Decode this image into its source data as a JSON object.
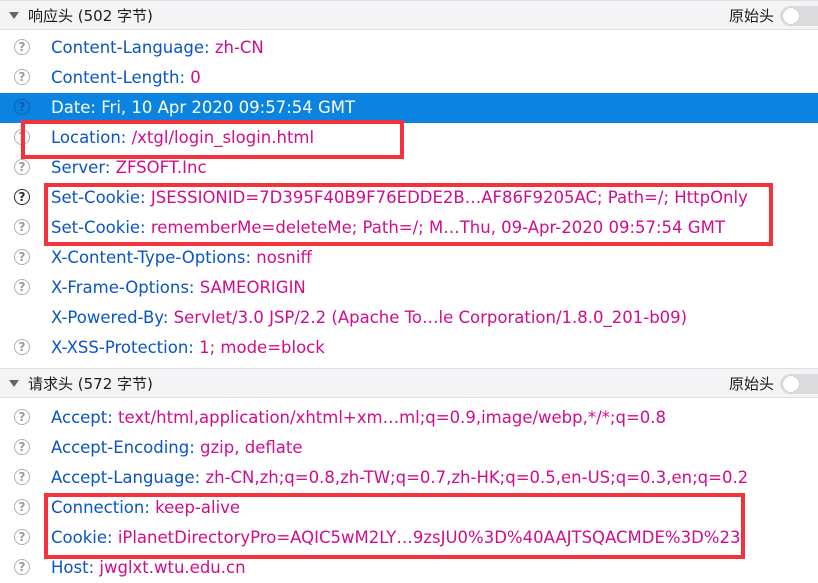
{
  "response_section": {
    "title": "响应头 (502 字节)",
    "raw_label": "原始头",
    "rows": [
      {
        "name": "Content-Language:",
        "value": "zh-CN"
      },
      {
        "name": "Content-Length:",
        "value": "0"
      },
      {
        "name": "Date:",
        "value": "Fri, 10 Apr 2020 09:57:54 GMT"
      },
      {
        "name": "Location:",
        "value": "/xtgl/login_slogin.html"
      },
      {
        "name": "Server:",
        "value": "ZFSOFT.Inc"
      },
      {
        "name": "Set-Cookie:",
        "value": "JSESSIONID=7D395F40B9F76EDDE2B…AF86F9205AC; Path=/; HttpOnly"
      },
      {
        "name": "Set-Cookie:",
        "value": "rememberMe=deleteMe; Path=/; M…Thu, 09-Apr-2020 09:57:54 GMT"
      },
      {
        "name": "X-Content-Type-Options:",
        "value": "nosniff"
      },
      {
        "name": "X-Frame-Options:",
        "value": "SAMEORIGIN"
      },
      {
        "name": "X-Powered-By:",
        "value": "Servlet/3.0 JSP/2.2 (Apache To…le Corporation/1.8.0_201-b09)"
      },
      {
        "name": "X-XSS-Protection:",
        "value": "1; mode=block"
      }
    ]
  },
  "request_section": {
    "title": "请求头 (572 字节)",
    "raw_label": "原始头",
    "rows": [
      {
        "name": "Accept:",
        "value": "text/html,application/xhtml+xm…ml;q=0.9,image/webp,*/*;q=0.8"
      },
      {
        "name": "Accept-Encoding:",
        "value": "gzip, deflate"
      },
      {
        "name": "Accept-Language:",
        "value": "zh-CN,zh;q=0.8,zh-TW;q=0.7,zh-HK;q=0.5,en-US;q=0.3,en;q=0.2"
      },
      {
        "name": "Connection:",
        "value": "keep-alive"
      },
      {
        "name": "Cookie:",
        "value": "iPlanetDirectoryPro=AQIC5wM2LY…9zsJU0%3D%40AAJTSQACMDE%3D%23"
      },
      {
        "name": "Host:",
        "value": "jwglxt.wtu.edu.cn"
      }
    ]
  },
  "help_icon_glyph": "?",
  "icons": {
    "help": "help-circle-icon",
    "collapse": "triangle-down-icon"
  },
  "colors": {
    "header_name": "#0a55c4",
    "header_value": "#d10d8b",
    "selection": "#0a84e0",
    "annotation": "#f4323c"
  }
}
